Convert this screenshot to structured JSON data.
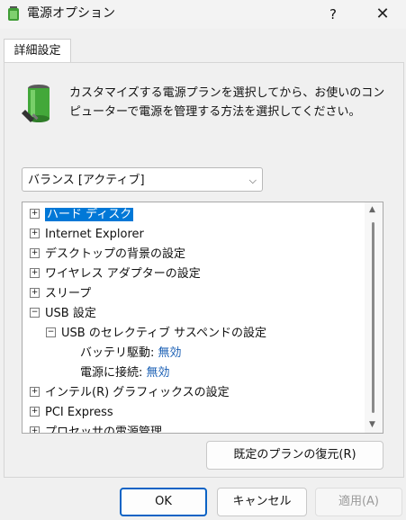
{
  "window": {
    "title": "電源オプション",
    "help_label": "?",
    "close_label": "✕"
  },
  "tab": {
    "label": "詳細設定"
  },
  "description": "カスタマイズする電源プランを選択してから、お使いのコンピューターで電源を管理する方法を選択してください。",
  "plan_select": {
    "value": "バランス [アクティブ]",
    "chevron": "⌵"
  },
  "tree": {
    "items": [
      {
        "expander": "+",
        "label": "ハード ディスク",
        "selected": true
      },
      {
        "expander": "+",
        "label": "Internet Explorer"
      },
      {
        "expander": "+",
        "label": "デスクトップの背景の設定"
      },
      {
        "expander": "+",
        "label": "ワイヤレス アダプターの設定"
      },
      {
        "expander": "+",
        "label": "スリープ"
      },
      {
        "expander": "−",
        "label": "USB 設定"
      },
      {
        "expander": "−",
        "label": "USB のセレクティブ サスペンドの設定"
      },
      {
        "label": "バッテリ駆動:",
        "value": "無効"
      },
      {
        "label": "電源に接続:",
        "value": "無効"
      },
      {
        "expander": "+",
        "label": "インテル(R) グラフィックスの設定"
      },
      {
        "expander": "+",
        "label": "PCI Express"
      },
      {
        "expander": "+",
        "label": "プロセッサの電源管理"
      }
    ]
  },
  "buttons": {
    "restore": "既定のプランの復元(R)",
    "ok": "OK",
    "cancel": "キャンセル",
    "apply": "適用(A)"
  },
  "colors": {
    "selection": "#0078d7",
    "link": "#1a5fb4",
    "accent_border": "#0b63c5"
  }
}
